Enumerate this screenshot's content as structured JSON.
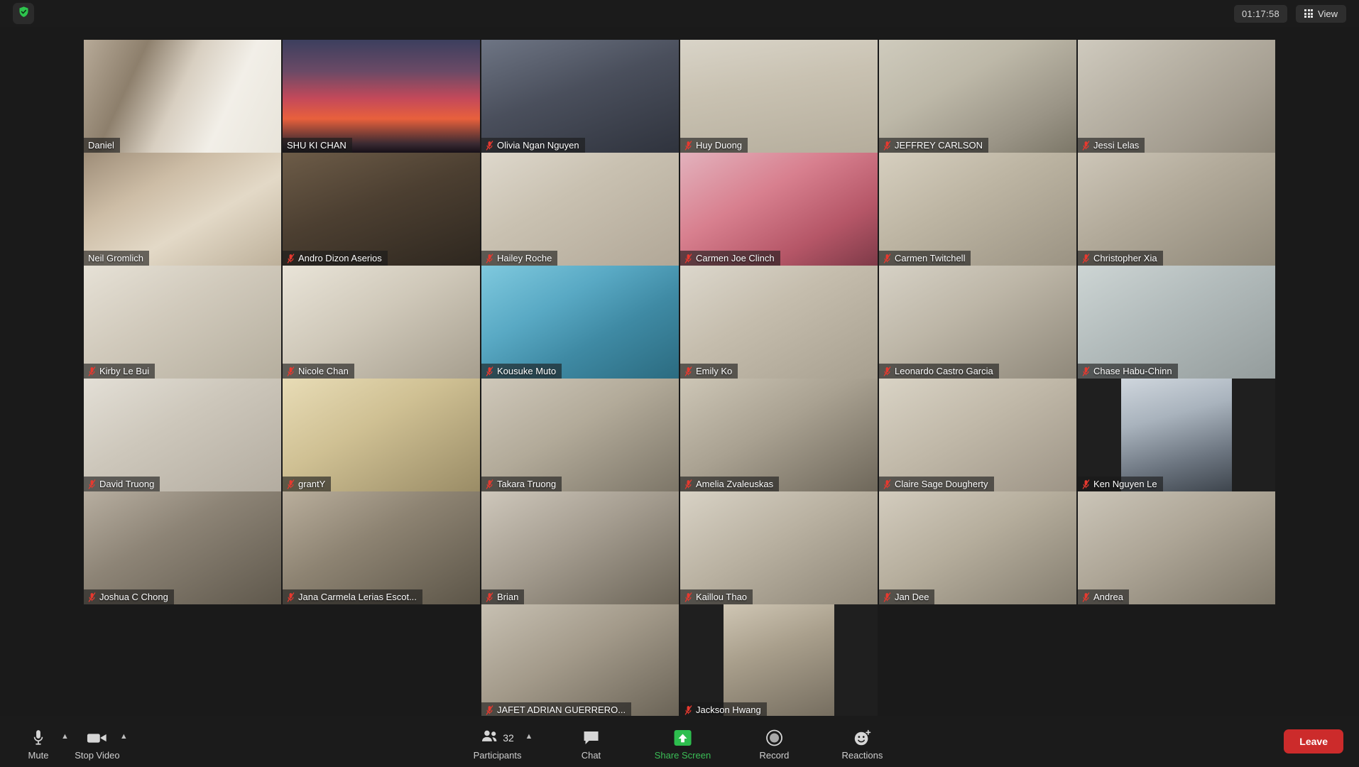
{
  "app": {
    "name": "Zoom Meeting",
    "accent_speaker": "#a8e043",
    "accent_green": "#3bbd56",
    "leave_red": "#cc2b2b"
  },
  "topbar": {
    "security_icon": "shield-check-icon",
    "timer": "01:17:58",
    "view_label": "View",
    "view_icon": "grid-icon"
  },
  "gallery": {
    "rows": [
      [
        {
          "name": "Daniel",
          "muted": false,
          "active": false,
          "portrait": false,
          "bg": "linear-gradient(115deg,#b7aa98 0%,#8d7f6c 26%,#d8cfc1 48%,#f2efe8 70%,#e8e4da 100%)"
        },
        {
          "name": "SHU KI CHAN",
          "muted": false,
          "active": true,
          "portrait": false,
          "bg": "linear-gradient(180deg,#3c3f5e 0%,#6b4a66 28%,#c4495a 52%,#e8603c 70%,#3a2a32 92%,#161018 100%)"
        },
        {
          "name": "Olivia Ngan Nguyen",
          "muted": true,
          "active": false,
          "portrait": false,
          "bg": "linear-gradient(160deg,#6e7584 0%,#4a4f5c 45%,#2f333d 100%)"
        },
        {
          "name": "Huy Duong",
          "muted": true,
          "active": false,
          "portrait": false,
          "bg": "linear-gradient(170deg,#d9d4c8 0%,#c9c2b2 40%,#b5ad9c 100%)"
        },
        {
          "name": "JEFFREY CARLSON",
          "muted": true,
          "active": false,
          "portrait": false,
          "bg": "linear-gradient(150deg,#cfcbbd 0%,#bdb8a8 38%,#9a9486 75%,#7c7768 100%)"
        },
        {
          "name": "Jessi Lelas",
          "muted": true,
          "active": false,
          "portrait": false,
          "bg": "linear-gradient(145deg,#cfcabe 0%,#b9b3a6 35%,#a49d90 70%,#8e8779 100%)"
        }
      ],
      [
        {
          "name": "Neil Gromlich",
          "muted": false,
          "active": false,
          "portrait": false,
          "bg": "linear-gradient(150deg,#9e8d78 0%,#cdbda6 32%,#e3d9c7 60%,#bdb09a 100%)"
        },
        {
          "name": "Andro Dizon Aserios",
          "muted": true,
          "active": false,
          "portrait": false,
          "bg": "linear-gradient(160deg,#6d5c48 0%,#4c3f31 45%,#2e271f 100%)"
        },
        {
          "name": "Hailey Roche",
          "muted": true,
          "active": false,
          "portrait": false,
          "bg": "linear-gradient(150deg,#ded8cc 0%,#c9c1b1 40%,#b1a797 100%)"
        },
        {
          "name": "Carmen Joe Clinch",
          "muted": true,
          "active": false,
          "portrait": false,
          "bg": "linear-gradient(150deg,#e3b2bd 0%,#d8808f 38%,#b55667 72%,#7e3a48 100%)"
        },
        {
          "name": "Carmen Twitchell",
          "muted": true,
          "active": false,
          "portrait": false,
          "bg": "linear-gradient(150deg,#d6cfbf 0%,#bdb5a3 42%,#9b9383 100%)"
        },
        {
          "name": "Christopher Xia",
          "muted": true,
          "active": false,
          "portrait": false,
          "bg": "linear-gradient(150deg,#cdc6b8 0%,#b2aa9a 42%,#8e8778 100%)"
        }
      ],
      [
        {
          "name": "Kirby Le Bui",
          "muted": true,
          "active": false,
          "portrait": false,
          "bg": "linear-gradient(150deg,#e6e1d6 0%,#d1cabc 42%,#b5ae9e 100%)"
        },
        {
          "name": "Nicole Chan",
          "muted": true,
          "active": false,
          "portrait": false,
          "bg": "linear-gradient(150deg,#e9e4d8 0%,#cfc8b9 45%,#a69e8e 100%)"
        },
        {
          "name": "Kousuke Muto",
          "muted": true,
          "active": false,
          "portrait": false,
          "bg": "linear-gradient(150deg,#7fc9de 0%,#59a9c4 35%,#3f8aa4 62%,#2b6b80 100%)"
        },
        {
          "name": "Emily Ko",
          "muted": true,
          "active": false,
          "portrait": false,
          "bg": "linear-gradient(150deg,#dcd7cc 0%,#c5bdad 42%,#a79f8f 100%)"
        },
        {
          "name": "Leonardo Castro Garcia",
          "muted": true,
          "active": false,
          "portrait": false,
          "bg": "linear-gradient(150deg,#d6d1c5 0%,#bdb6a7 42%,#8f887a 100%)"
        },
        {
          "name": "Chase Habu-Chinn",
          "muted": true,
          "active": false,
          "portrait": false,
          "bg": "linear-gradient(150deg,#cdd5d4 0%,#b3bcbc 42%,#949c9c 100%)"
        }
      ],
      [
        {
          "name": "David Truong",
          "muted": true,
          "active": false,
          "portrait": false,
          "bg": "linear-gradient(150deg,#e3dfd6 0%,#cdc7bb 42%,#b3aca0 100%)"
        },
        {
          "name": "grantY",
          "muted": true,
          "active": false,
          "portrait": false,
          "bg": "linear-gradient(150deg,#e8dcb6 0%,#cfc093 42%,#9a8c66 100%)"
        },
        {
          "name": "Takara Truong",
          "muted": true,
          "active": false,
          "portrait": false,
          "bg": "linear-gradient(150deg,#cfc8ba 0%,#b2aa99 45%,#7d7668 100%)"
        },
        {
          "name": "Amelia Zvaleuskas",
          "muted": true,
          "active": false,
          "portrait": false,
          "bg": "linear-gradient(150deg,#cdc6b6 0%,#a9a191 45%,#6e675a 100%)"
        },
        {
          "name": "Claire Sage Dougherty",
          "muted": true,
          "active": false,
          "portrait": false,
          "bg": "linear-gradient(150deg,#d9d3c5 0%,#c0b8a8 45%,#9d9486 100%)"
        },
        {
          "name": "Ken Nguyen Le",
          "muted": true,
          "active": false,
          "portrait": true,
          "bg": "linear-gradient(165deg,#cfd6dd 0%,#a9b3bd 35%,#6c7580 70%,#3e454d 100%)"
        }
      ],
      [
        {
          "name": "Joshua C Chong",
          "muted": true,
          "active": false,
          "portrait": false,
          "bg": "linear-gradient(150deg,#b7aea0 0%,#8d8476 40%,#5f584c 100%)"
        },
        {
          "name": "Jana Carmela Lerias Escot...",
          "muted": true,
          "active": false,
          "portrait": false,
          "bg": "linear-gradient(150deg,#b9ae9c 0%,#8d8372 42%,#5c5548 100%)"
        },
        {
          "name": "Brian",
          "muted": true,
          "active": false,
          "portrait": false,
          "bg": "linear-gradient(150deg,#cec7bb 0%,#a59d90 45%,#6c6558 100%)"
        },
        {
          "name": "Kaillou Thao",
          "muted": true,
          "active": false,
          "portrait": false,
          "bg": "linear-gradient(150deg,#d8d2c5 0%,#b9b1a1 45%,#8d8576 100%)"
        },
        {
          "name": "Jan Dee",
          "muted": true,
          "active": false,
          "portrait": false,
          "bg": "linear-gradient(150deg,#d3ccbe 0%,#b5ad9c 45%,#857e70 100%)"
        },
        {
          "name": "Andrea",
          "muted": true,
          "active": false,
          "portrait": false,
          "bg": "linear-gradient(150deg,#cbc5b8 0%,#ada596 45%,#7e7769 100%)"
        }
      ],
      [
        {
          "name": "JAFET ADRIAN GUERRERO...",
          "muted": true,
          "active": false,
          "portrait": false,
          "bg": "linear-gradient(150deg,#c7c0b2 0%,#a39a8a 45%,#6a6356 100%)"
        },
        {
          "name": "Jackson Hwang",
          "muted": true,
          "active": false,
          "portrait": true,
          "bg": "linear-gradient(160deg,#cfc6b4 0%,#a99f8c 40%,#756d5f 100%)"
        }
      ]
    ]
  },
  "toolbar": {
    "mute": {
      "label": "Mute",
      "icon": "microphone-icon"
    },
    "video": {
      "label": "Stop Video",
      "icon": "video-camera-icon"
    },
    "participants": {
      "label": "Participants",
      "count": "32",
      "icon": "people-icon"
    },
    "chat": {
      "label": "Chat",
      "icon": "chat-bubble-icon"
    },
    "share": {
      "label": "Share Screen",
      "icon": "share-screen-icon"
    },
    "record": {
      "label": "Record",
      "icon": "record-circle-icon"
    },
    "reactions": {
      "label": "Reactions",
      "icon": "smiley-plus-icon"
    },
    "leave": {
      "label": "Leave"
    }
  }
}
